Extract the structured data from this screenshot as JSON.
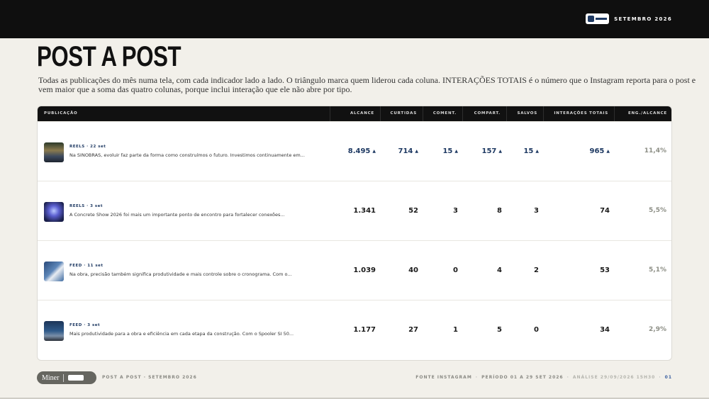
{
  "header": {
    "period": "SETEMBRO 2026"
  },
  "page": {
    "title": "POST A POST",
    "intro": "Todas as publicações do mês numa tela, com cada indicador lado a lado. O triângulo marca quem liderou cada coluna. INTERAÇÕES TOTAIS é o número que o Instagram reporta para o post e vem maior que a soma das quatro colunas, porque inclui interação que ele não abre por tipo."
  },
  "table": {
    "columns": {
      "publicacao": "PUBLICAÇÃO",
      "alcance": "ALCANCE",
      "curtidas": "CURTIDAS",
      "coment": "COMENT.",
      "compart": "COMPART.",
      "salvos": "SALVOS",
      "interacoes": "INTERAÇÕES TOTAIS",
      "eng": "ENG./ALCANCE"
    },
    "leader_marker": "▲",
    "rows": [
      {
        "meta": "REELS · 22 set",
        "caption": "Na SINOBRAS, evoluir faz parte da forma como construímos o futuro. Investimos continuamente em...",
        "alcance": "8.495",
        "curtidas": "714",
        "coment": "15",
        "compart": "157",
        "salvos": "15",
        "interacoes": "965",
        "eng": "11,4%"
      },
      {
        "meta": "REELS · 3 set",
        "caption": "A Concrete Show 2026 foi mais um importante ponto de encontro para fortalecer conexões...",
        "alcance": "1.341",
        "curtidas": "52",
        "coment": "3",
        "compart": "8",
        "salvos": "3",
        "interacoes": "74",
        "eng": "5,5%"
      },
      {
        "meta": "FEED · 11 set",
        "caption": "Na obra, precisão também significa produtividade e mais controle sobre o cronograma. Com o...",
        "alcance": "1.039",
        "curtidas": "40",
        "coment": "0",
        "compart": "4",
        "salvos": "2",
        "interacoes": "53",
        "eng": "5,1%"
      },
      {
        "meta": "FEED · 3 set",
        "caption": "Mais produtividade para a obra e eficiência em cada etapa da construção. Com o Spooler SI 50...",
        "alcance": "1.177",
        "curtidas": "27",
        "coment": "1",
        "compart": "5",
        "salvos": "0",
        "interacoes": "34",
        "eng": "2,9%"
      }
    ]
  },
  "footer": {
    "brand": "Miner",
    "left_label": "POST A POST · SETEMBRO 2026",
    "source": "FONTE INSTAGRAM",
    "period": "PERÍODO 01 A 29 SET 2026",
    "analysis": "ANÁLISE 29/09/2026 15H30",
    "page": "01"
  },
  "colors": {
    "topbar": "#0f0f0f",
    "background": "#f2f0ea",
    "accent": "#1f3a63",
    "eng_text": "#8d8f86"
  }
}
